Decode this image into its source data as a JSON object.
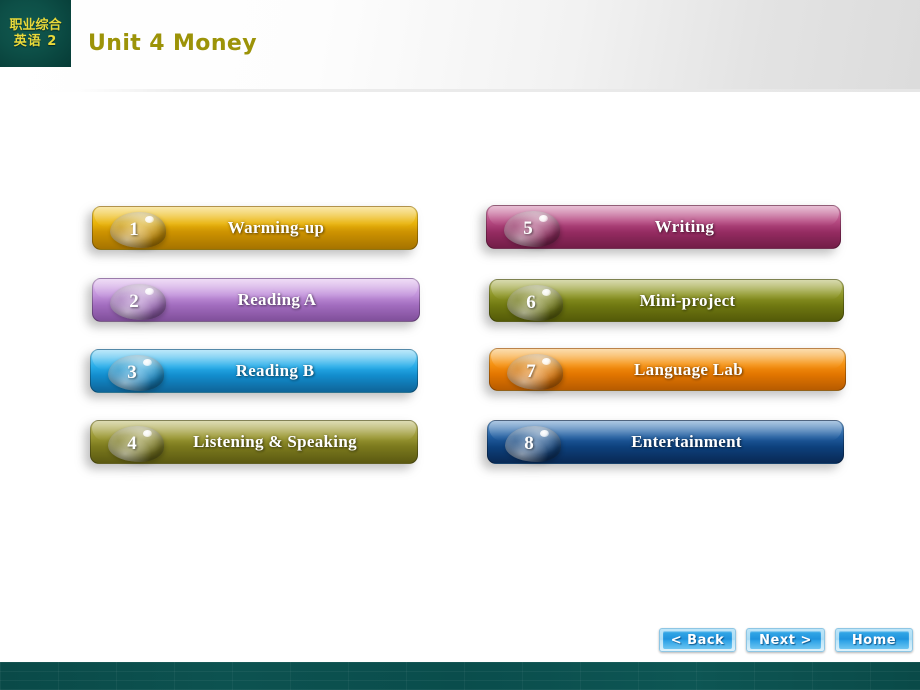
{
  "header": {
    "logo_line1": "职业综合",
    "logo_line2": "英语 2",
    "title": "Unit 4 Money",
    "logo_bg": "#0d4f47",
    "logo_text_color": "#e9d93a",
    "title_color": "#9c9308"
  },
  "menu": {
    "left_column": [
      {
        "number": "1",
        "label": "Warming-up",
        "color": "#e0a800",
        "color_dark": "#c08a00"
      },
      {
        "number": "2",
        "label": "Reading A",
        "color": "#b983d6",
        "color_dark": "#9b5fbf"
      },
      {
        "number": "3",
        "label": "Reading B",
        "color": "#22a3e2",
        "color_dark": "#1480c0"
      },
      {
        "number": "4",
        "label": "Listening & Speaking",
        "color": "#8e8c25",
        "color_dark": "#6f6d18"
      }
    ],
    "right_column": [
      {
        "number": "5",
        "label": "Writing",
        "color": "#a83a74",
        "color_dark": "#8a2a5c"
      },
      {
        "number": "6",
        "label": "Mini-project",
        "color": "#7f8c14",
        "color_dark": "#636d0c"
      },
      {
        "number": "7",
        "label": "Language Lab",
        "color": "#f08000",
        "color_dark": "#d06800"
      },
      {
        "number": "8",
        "label": "Entertainment",
        "color": "#124a8c",
        "color_dark": "#0a3569"
      }
    ]
  },
  "nav": {
    "back_label": "< Back",
    "next_label": "Next >",
    "home_label": "Home"
  },
  "footer": {
    "color": "#0a4d4c"
  }
}
